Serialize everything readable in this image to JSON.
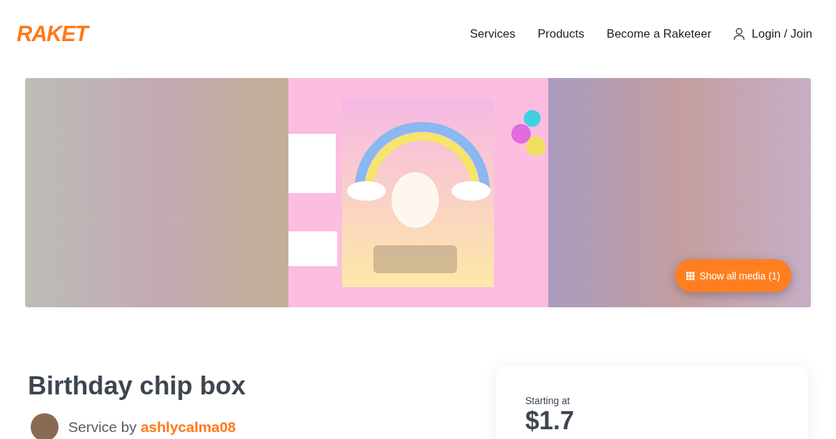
{
  "header": {
    "logo": "RAKET",
    "nav": [
      {
        "label": "Services"
      },
      {
        "label": "Products"
      },
      {
        "label": "Become a Raketeer"
      }
    ],
    "login": "Login / Join"
  },
  "gallery": {
    "kind": "picture",
    "button": "Show all media (1)"
  },
  "service": {
    "title": "Birthday chip box",
    "by": "Service by",
    "seller": "ashlycalma08"
  },
  "price": {
    "label": "Starting at",
    "value": "$1.7"
  }
}
